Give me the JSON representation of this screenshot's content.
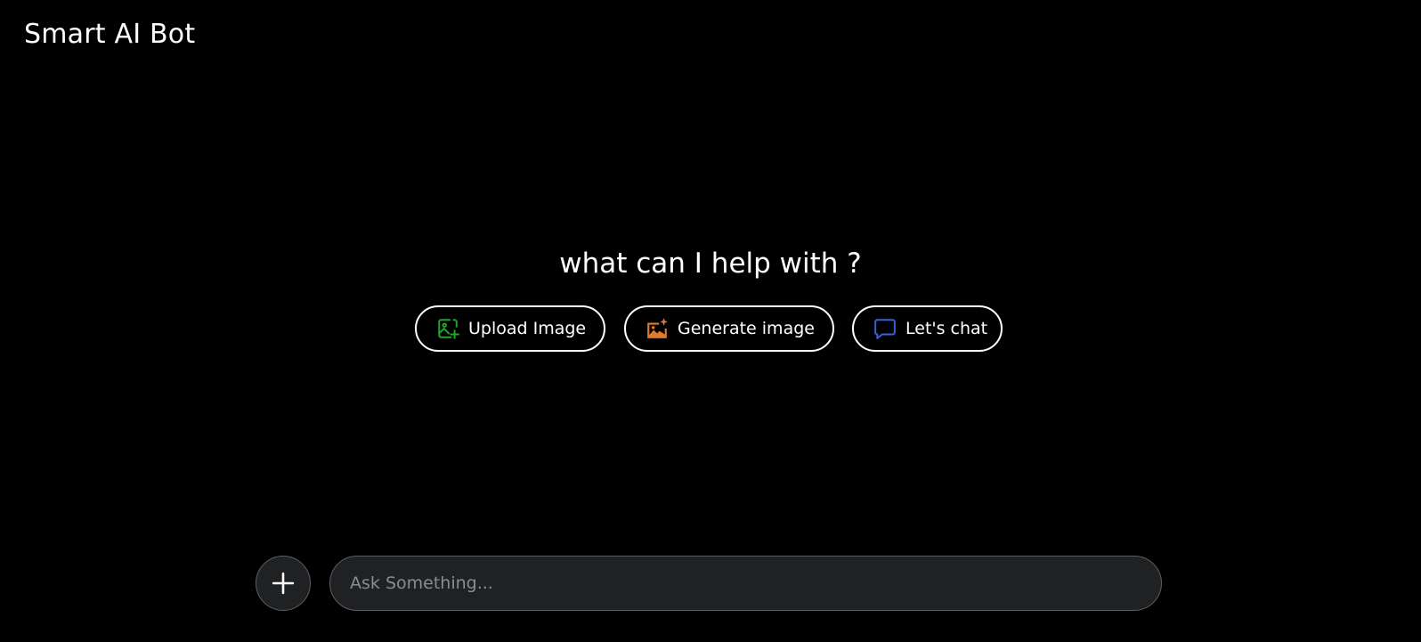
{
  "app": {
    "title": "Smart AI Bot"
  },
  "main": {
    "heading": "what can I help with ?",
    "actions": [
      {
        "label": "Upload Image",
        "icon": "image-plus-icon",
        "icon_color": "#22a52b"
      },
      {
        "label": "Generate image",
        "icon": "image-sparkle-icon",
        "icon_color": "#e07b2e"
      },
      {
        "label": "Let's chat",
        "icon": "chat-bubble-icon",
        "icon_color": "#3b5fe0"
      }
    ]
  },
  "composer": {
    "add_icon": "plus-icon",
    "input_placeholder": "Ask Something...",
    "input_value": ""
  },
  "colors": {
    "background": "#000000",
    "text": "#ffffff",
    "input_background": "#1f2123",
    "input_border": "#5c5f62",
    "placeholder": "#8a8c8e"
  }
}
